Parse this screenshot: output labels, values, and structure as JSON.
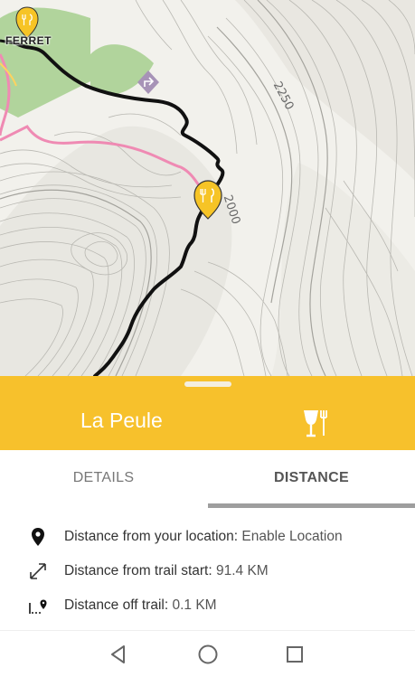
{
  "map": {
    "place_label": "FERRET",
    "contour_labels": [
      "2250",
      "2000"
    ]
  },
  "poi": {
    "name": "La Peule",
    "type_icon": "restaurant-icon",
    "header_color": "#f7c12c"
  },
  "tabs": {
    "details_label": "DETAILS",
    "distance_label": "DISTANCE",
    "active": "DISTANCE"
  },
  "distance": {
    "from_location_label": "Distance from your location:",
    "from_location_value": "Enable Location",
    "from_trail_start_label": "Distance from trail start:",
    "from_trail_start_value": "91.4 KM",
    "off_trail_label": "Distance off trail:",
    "off_trail_value": "0.1 KM"
  },
  "navbar": {
    "back_icon": "back-triangle-icon",
    "home_icon": "home-circle-icon",
    "recents_icon": "recents-square-icon"
  }
}
